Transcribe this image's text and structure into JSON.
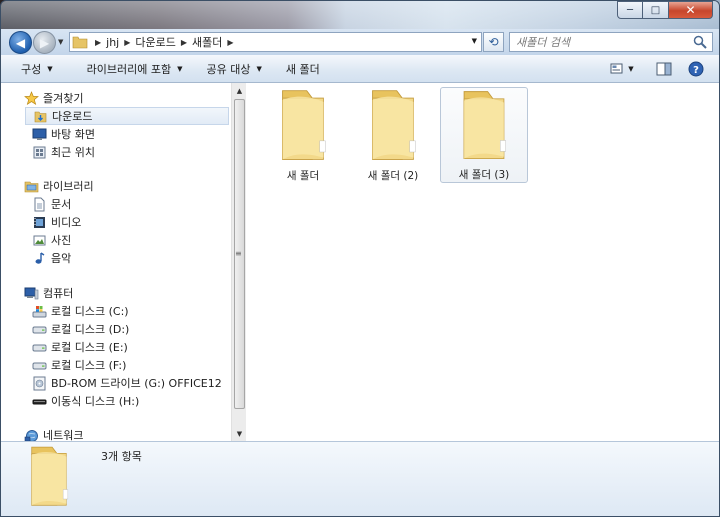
{
  "window": {
    "caption_min": "─",
    "caption_max": "□",
    "caption_close": "✕"
  },
  "address": {
    "crumbs": [
      "jhj",
      "다운로드",
      "새폴더"
    ],
    "search_placeholder": "새폴더 검색"
  },
  "toolbar": {
    "organize": "구성",
    "include_library": "라이브러리에 포함",
    "share": "공유 대상",
    "new_folder": "새 폴더"
  },
  "nav": {
    "favorites": {
      "label": "즐겨찾기",
      "items": [
        "다운로드",
        "바탕 화면",
        "최근 위치"
      ]
    },
    "libraries": {
      "label": "라이브러리",
      "items": [
        "문서",
        "비디오",
        "사진",
        "음악"
      ]
    },
    "computer": {
      "label": "컴퓨터",
      "items": [
        "로컬 디스크 (C:)",
        "로컬 디스크 (D:)",
        "로컬 디스크 (E:)",
        "로컬 디스크 (F:)",
        "BD-ROM 드라이브 (G:) OFFICE12",
        "이동식 디스크 (H:)"
      ]
    },
    "network": {
      "label": "네트워크"
    }
  },
  "files": [
    {
      "name": "새 폴더"
    },
    {
      "name": "새 폴더 (2)"
    },
    {
      "name": "새 폴더 (3)"
    }
  ],
  "details": {
    "count": "3개 항목"
  },
  "colors": {
    "folder_light": "#f6e3a0",
    "folder_dark": "#e3bf5e",
    "selection_border": "#b9c7d8"
  }
}
